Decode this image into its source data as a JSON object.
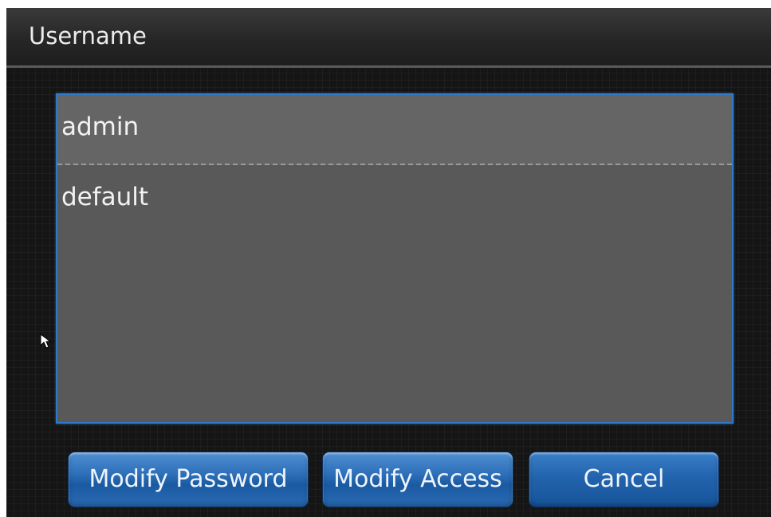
{
  "dialog": {
    "title": "Username"
  },
  "user_list": {
    "selected_index": 0,
    "items": [
      {
        "label": "admin"
      },
      {
        "label": "default"
      }
    ]
  },
  "buttons": {
    "modify_password": "Modify Password",
    "modify_access": "Modify Access",
    "cancel": "Cancel"
  },
  "colors": {
    "accent": "#2f79c6",
    "list_background": "#595959",
    "dialog_background": "#151515"
  },
  "icons": {
    "cursor": "mouse-pointer-icon"
  }
}
